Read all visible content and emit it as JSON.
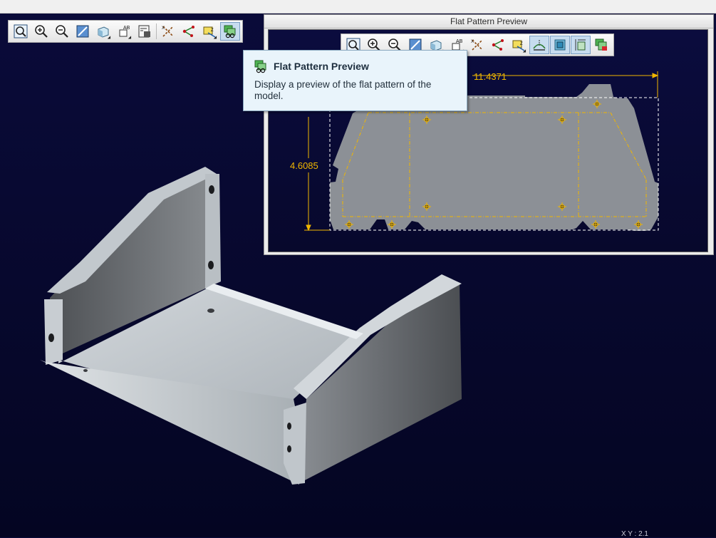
{
  "main_toolbar": {
    "buttons": [
      {
        "name": "refit-icon",
        "tip": "Refit"
      },
      {
        "name": "zoom-in-icon",
        "tip": "Zoom In"
      },
      {
        "name": "zoom-out-icon",
        "tip": "Zoom Out"
      },
      {
        "name": "repaint-icon",
        "tip": "Repaint"
      },
      {
        "name": "display-style-icon",
        "tip": "Display Style"
      },
      {
        "name": "annotation-display-icon",
        "tip": "Annotation Display"
      },
      {
        "name": "view-manager-icon",
        "tip": "View Manager"
      },
      {
        "name": "datum-axes-icon",
        "tip": "Axes Display"
      },
      {
        "name": "datum-points-icon",
        "tip": "Point Display"
      },
      {
        "name": "csys-display-icon",
        "tip": "Csys Display"
      },
      {
        "name": "flat-pattern-preview-icon",
        "tip": "Flat Pattern Preview",
        "active": true
      }
    ]
  },
  "flat_pattern_window": {
    "title": "Flat Pattern Preview",
    "dim_width": "11.4371",
    "dim_height": "4.6085"
  },
  "tooltip": {
    "title": "Flat Pattern Preview",
    "description": "Display a preview of the flat pattern of the model."
  },
  "status": {
    "coords": "X Y : 2.1"
  },
  "colors": {
    "background": "#07082d",
    "dimension": "#f0b600",
    "part": "#8c9096"
  }
}
